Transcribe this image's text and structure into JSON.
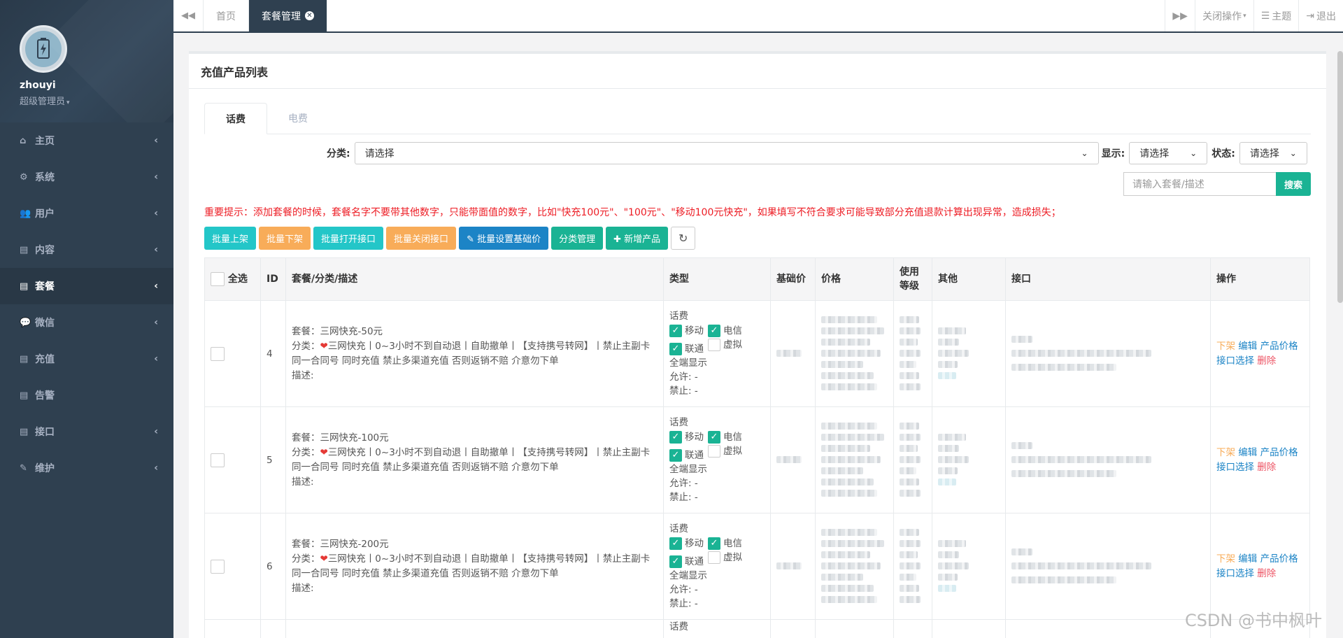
{
  "sidebar": {
    "username": "zhouyi",
    "role": "超级管理员",
    "items": [
      {
        "label": "主页",
        "icon": "home-icon",
        "glyph": "⌂",
        "active": false,
        "arrow": true
      },
      {
        "label": "系统",
        "icon": "gears-icon",
        "glyph": "⚙",
        "active": false,
        "arrow": true
      },
      {
        "label": "用户",
        "icon": "users-icon",
        "glyph": "👥",
        "active": false,
        "arrow": true
      },
      {
        "label": "内容",
        "icon": "file-icon",
        "glyph": "▤",
        "active": false,
        "arrow": true
      },
      {
        "label": "套餐",
        "icon": "file-icon",
        "glyph": "▤",
        "active": true,
        "arrow": true
      },
      {
        "label": "微信",
        "icon": "wechat-icon",
        "glyph": "💬",
        "active": false,
        "arrow": true
      },
      {
        "label": "充值",
        "icon": "file-icon",
        "glyph": "▤",
        "active": false,
        "arrow": true
      },
      {
        "label": "告警",
        "icon": "file-icon",
        "glyph": "▤",
        "active": false,
        "arrow": false
      },
      {
        "label": "接口",
        "icon": "file-icon",
        "glyph": "▤",
        "active": false,
        "arrow": true
      },
      {
        "label": "维护",
        "icon": "wrench-icon",
        "glyph": "✎",
        "active": false,
        "arrow": true
      }
    ]
  },
  "topbar": {
    "tabs": [
      {
        "label": "首页",
        "active": false
      },
      {
        "label": "套餐管理",
        "active": true
      }
    ],
    "close_ops": "关闭操作",
    "theme": "主题",
    "logout": "退出"
  },
  "panel": {
    "title": "充值产品列表",
    "tabs": [
      "话费",
      "电费"
    ],
    "filters": {
      "category_label": "分类:",
      "category_value": "请选择",
      "display_label": "显示:",
      "display_value": "请选择",
      "status_label": "状态:",
      "status_value": "请选择"
    },
    "search": {
      "placeholder": "请输入套餐/描述",
      "button": "搜索"
    },
    "warning": "重要提示：添加套餐的时候，套餐名字不要带其他数字，只能带面值的数字，比如\"快充100元\"、\"100元\"、\"移动100元快充\"，如果填写不符合要求可能导致部分充值退款计算出现异常，造成损失；",
    "buttons": [
      {
        "label": "批量上架",
        "color": "#23c6c8"
      },
      {
        "label": "批量下架",
        "color": "#f8ac59"
      },
      {
        "label": "批量打开接口",
        "color": "#23c6c8"
      },
      {
        "label": "批量关闭接口",
        "color": "#f8ac59"
      },
      {
        "label": "✎ 批量设置基础价",
        "color": "#1c84c6"
      },
      {
        "label": "分类管理",
        "color": "#1ab394"
      },
      {
        "label": "✚ 新增产品",
        "color": "#1ab394"
      }
    ],
    "table": {
      "headers": {
        "select_all": "全选",
        "id": "ID",
        "pkg": "套餐/分类/描述",
        "type": "类型",
        "base_price": "基础价",
        "price": "价格",
        "level": "使用等级",
        "other": "其他",
        "iface": "接口",
        "ops": "操作"
      },
      "rows": [
        {
          "id": "4",
          "pkg": "套餐：三网快充-50元",
          "cat_prefix": "分类：",
          "cat": "三网快充丨0~3小时不到自动退丨自助撤单丨【支持携号转网】丨禁止主副卡 同一合同号 同时充值 禁止多渠道充值 否则返销不赔 介意勿下单",
          "desc": "描述:",
          "type_title": "话费",
          "opt_mobile": "移动",
          "opt_telecom": "电信",
          "opt_unicom": "联通",
          "opt_virtual": "虚拟",
          "all_display": "全端显示",
          "allow": "允许: -",
          "forbid": "禁止: -"
        },
        {
          "id": "5",
          "pkg": "套餐：三网快充-100元",
          "cat_prefix": "分类：",
          "cat": "三网快充丨0~3小时不到自动退丨自助撤单丨【支持携号转网】丨禁止主副卡 同一合同号 同时充值 禁止多渠道充值 否则返销不赔 介意勿下单",
          "desc": "描述:",
          "type_title": "话费",
          "opt_mobile": "移动",
          "opt_telecom": "电信",
          "opt_unicom": "联通",
          "opt_virtual": "虚拟",
          "all_display": "全端显示",
          "allow": "允许: -",
          "forbid": "禁止: -"
        },
        {
          "id": "6",
          "pkg": "套餐：三网快充-200元",
          "cat_prefix": "分类：",
          "cat": "三网快充丨0~3小时不到自动退丨自助撤单丨【支持携号转网】丨禁止主副卡 同一合同号 同时充值 禁止多渠道充值 否则返销不赔 介意勿下单",
          "desc": "描述:",
          "type_title": "话费",
          "opt_mobile": "移动",
          "opt_telecom": "电信",
          "opt_unicom": "联通",
          "opt_virtual": "虚拟",
          "all_display": "全端显示",
          "allow": "允许: -",
          "forbid": "禁止: -"
        }
      ],
      "actions": {
        "off_shelf": "下架",
        "edit": "编辑",
        "product_price": "产品价格",
        "iface_select": "接口选择",
        "delete": "删除"
      },
      "partial_row_type": "话费"
    }
  },
  "watermark": "CSDN @书中枫叶",
  "colors": {
    "sidebar_bg": "#2f4050",
    "accent_green": "#1ab394",
    "info": "#23c6c8",
    "warning": "#f8ac59",
    "primary": "#1c84c6",
    "danger": "#ed5565"
  }
}
